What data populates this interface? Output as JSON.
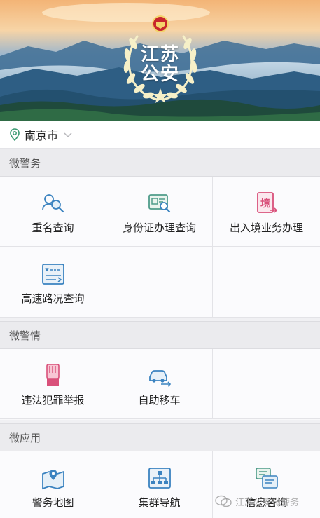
{
  "banner": {
    "emblem_line1": "江苏",
    "emblem_line2": "公安"
  },
  "location": {
    "city": "南京市"
  },
  "sections": [
    {
      "title": "微警务",
      "items": [
        {
          "label": "重名查询",
          "icon": "people-search-icon"
        },
        {
          "label": "身份证办理查询",
          "icon": "id-card-search-icon"
        },
        {
          "label": "出入境业务办理",
          "icon": "border-exit-entry-icon"
        },
        {
          "label": "高速路况查询",
          "icon": "highway-road-icon"
        }
      ]
    },
    {
      "title": "微警情",
      "items": [
        {
          "label": "违法犯罪举报",
          "icon": "report-hand-icon"
        },
        {
          "label": "自助移车",
          "icon": "car-move-icon"
        }
      ]
    },
    {
      "title": "微应用",
      "items": [
        {
          "label": "警务地图",
          "icon": "map-pin-icon"
        },
        {
          "label": "集群导航",
          "icon": "org-chart-icon"
        },
        {
          "label": "信息咨询",
          "icon": "chat-info-icon"
        }
      ]
    }
  ],
  "watermark": {
    "text": "江苏公安微警务"
  },
  "colors": {
    "icon_blue": "#3b83c0",
    "icon_pink": "#d9507a",
    "icon_teal": "#4f9c8a"
  }
}
